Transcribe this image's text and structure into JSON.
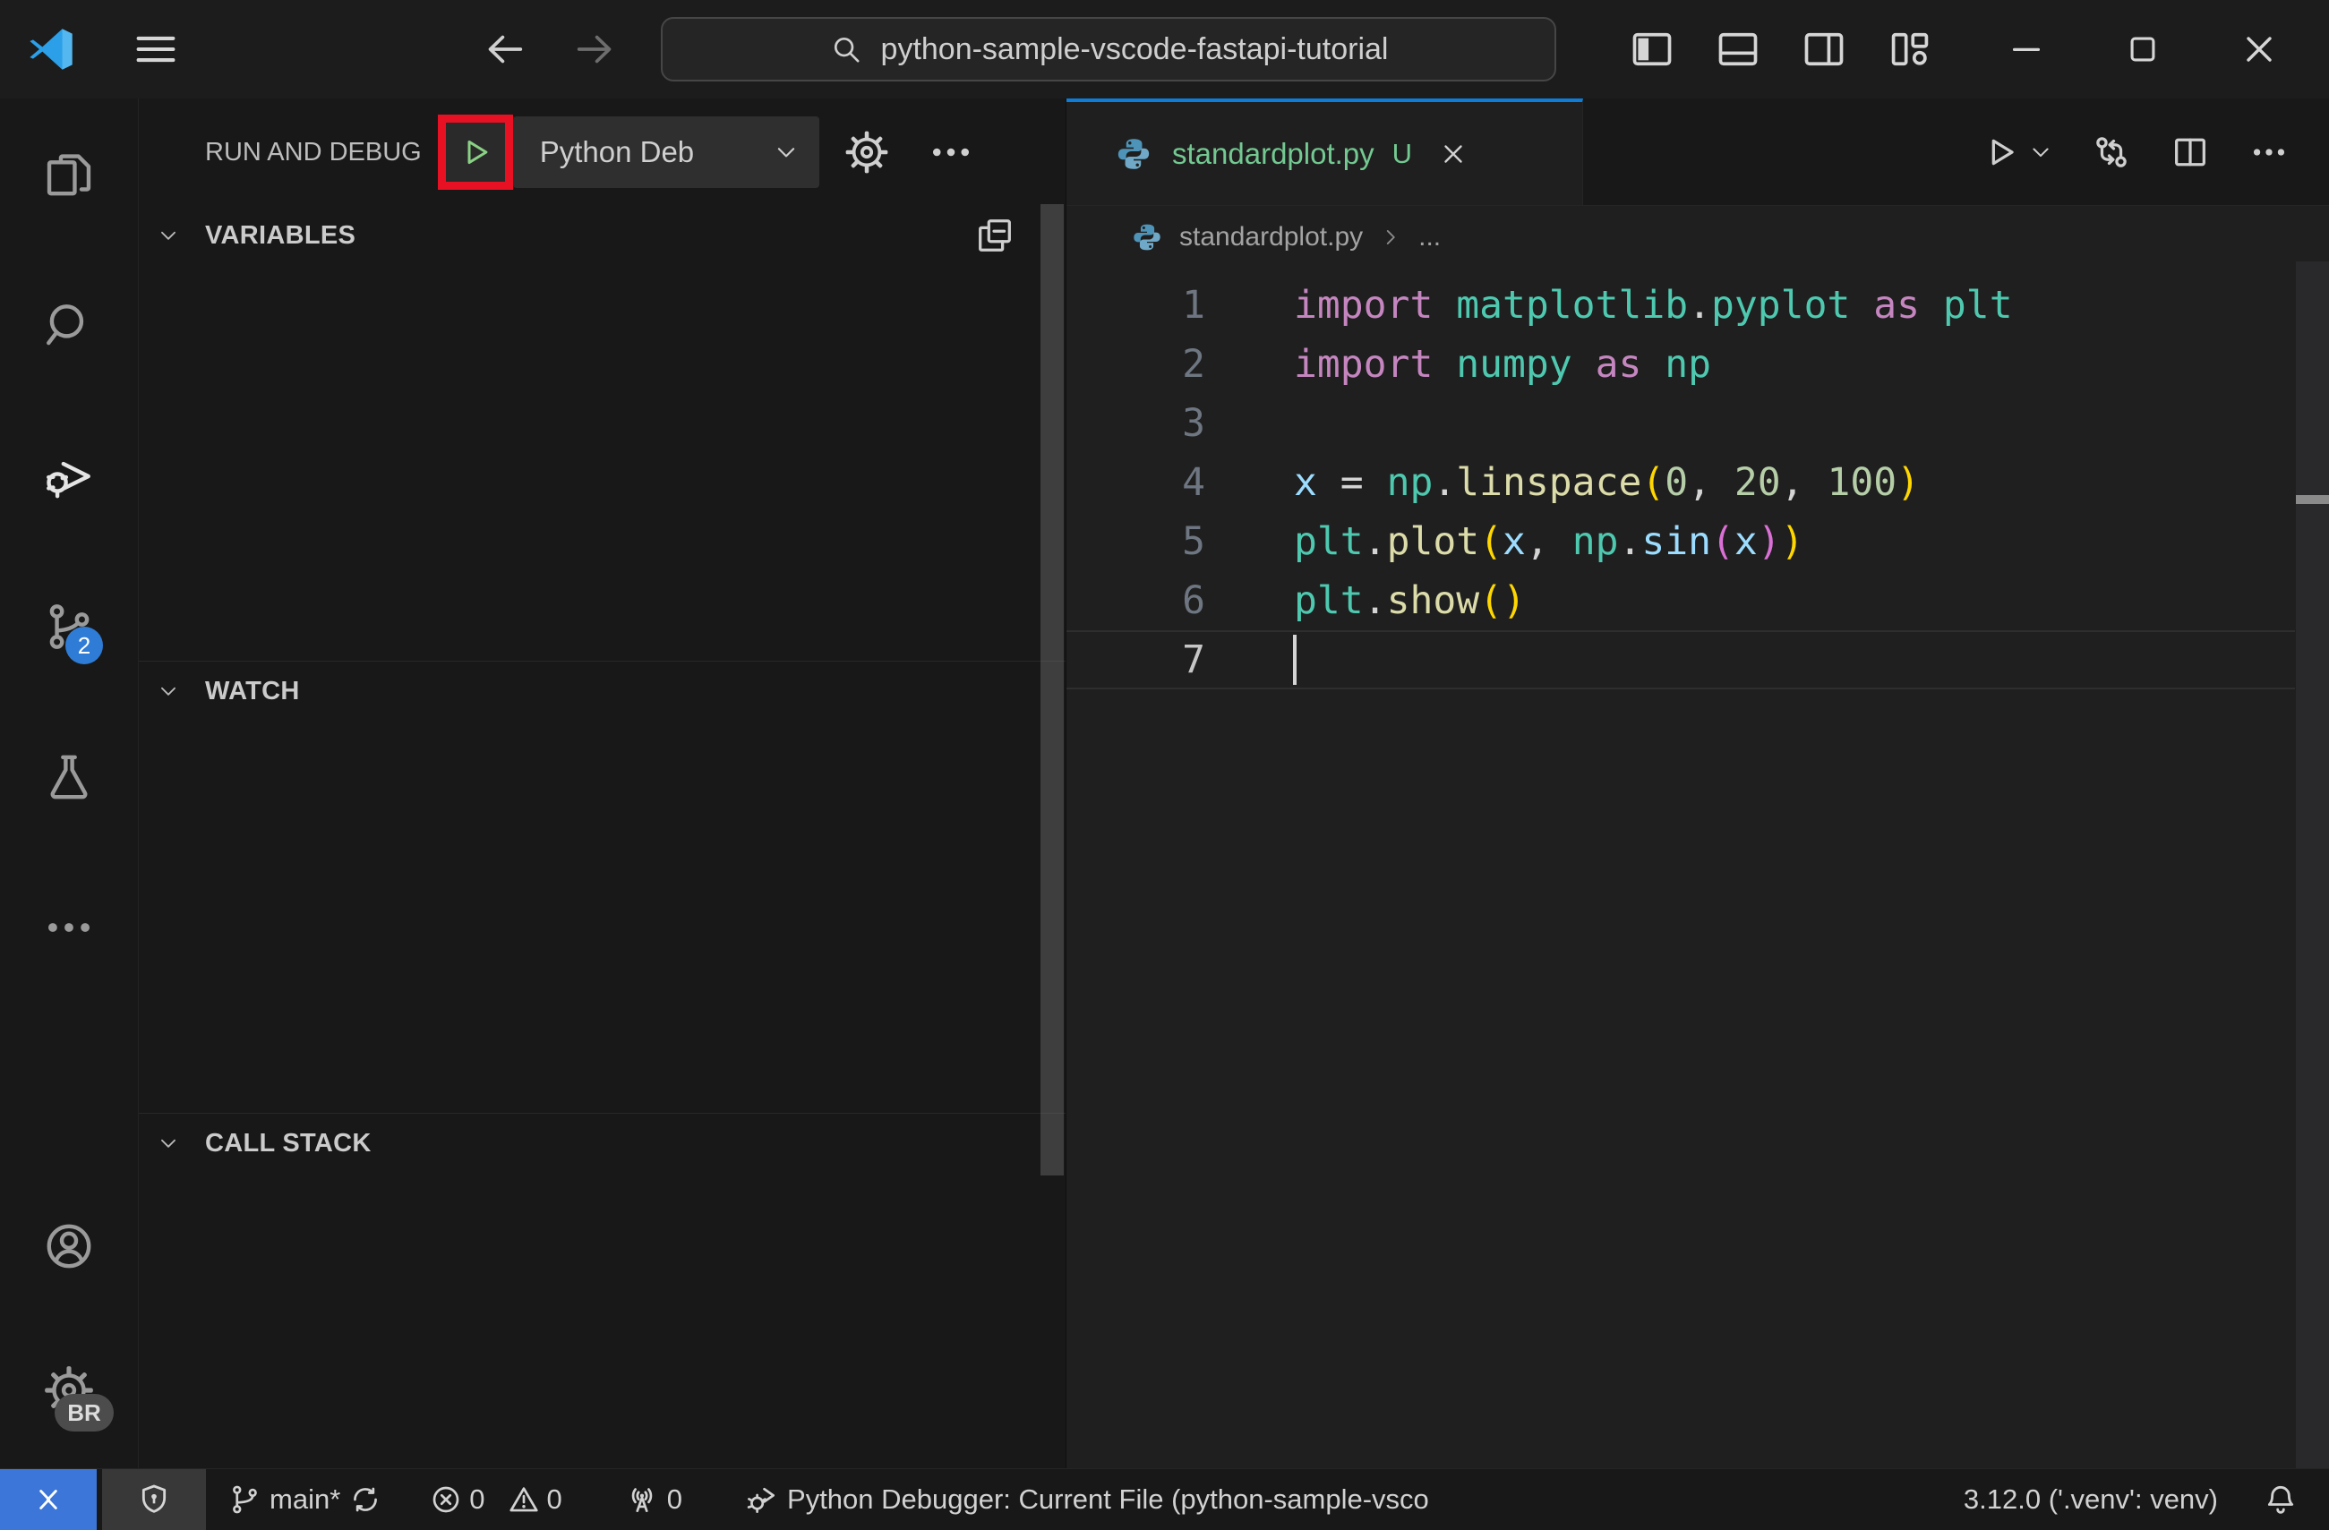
{
  "colors": {
    "accent-blue": "#0c7ed9",
    "remote-blue": "#3b76d8",
    "badge-blue": "#2f7cd6",
    "untracked-green": "#73C991",
    "play-green": "#89D185",
    "annotation-red": "#E81123"
  },
  "titlebar": {
    "search_text": "python-sample-vscode-fastapi-tutorial"
  },
  "activity_bar": {
    "scm_badge": "2",
    "profile_badge": "BR"
  },
  "run_panel": {
    "title": "RUN AND DEBUG",
    "config_label": "Python Deb",
    "sections": [
      {
        "label": "VARIABLES"
      },
      {
        "label": "WATCH"
      },
      {
        "label": "CALL STACK"
      }
    ]
  },
  "editor": {
    "tab": {
      "label": "standardplot.py",
      "modified": "U"
    },
    "breadcrumb": {
      "file": "standardplot.py",
      "symbol": "..."
    },
    "syntax_colors": {
      "kw": "#C586C0",
      "mod": "#4EC9B0",
      "fn": "#DCDCAA",
      "var": "#9CDCFE",
      "num": "#B5CEA8",
      "pl": "#D4D4D4",
      "b1": "#FFD700",
      "b2": "#DA70D6"
    },
    "lines": [
      {
        "num": "1",
        "tokens": [
          [
            "import",
            "kw"
          ],
          [
            " ",
            "pl"
          ],
          [
            "matplotlib",
            "mod"
          ],
          [
            ".",
            "pl"
          ],
          [
            "pyplot",
            "mod"
          ],
          [
            " ",
            "pl"
          ],
          [
            "as",
            "kw"
          ],
          [
            " ",
            "pl"
          ],
          [
            "plt",
            "mod"
          ]
        ]
      },
      {
        "num": "2",
        "tokens": [
          [
            "import",
            "kw"
          ],
          [
            " ",
            "pl"
          ],
          [
            "numpy",
            "mod"
          ],
          [
            " ",
            "pl"
          ],
          [
            "as",
            "kw"
          ],
          [
            " ",
            "pl"
          ],
          [
            "np",
            "mod"
          ]
        ]
      },
      {
        "num": "3",
        "tokens": []
      },
      {
        "num": "4",
        "tokens": [
          [
            "x",
            "var"
          ],
          [
            " = ",
            "pl"
          ],
          [
            "np",
            "mod"
          ],
          [
            ".",
            "pl"
          ],
          [
            "linspace",
            "fn"
          ],
          [
            "(",
            "b1"
          ],
          [
            "0",
            "num"
          ],
          [
            ", ",
            "pl"
          ],
          [
            "20",
            "num"
          ],
          [
            ", ",
            "pl"
          ],
          [
            "100",
            "num"
          ],
          [
            ")",
            "b1"
          ]
        ]
      },
      {
        "num": "5",
        "tokens": [
          [
            "plt",
            "mod"
          ],
          [
            ".",
            "pl"
          ],
          [
            "plot",
            "fn"
          ],
          [
            "(",
            "b1"
          ],
          [
            "x",
            "var"
          ],
          [
            ", ",
            "pl"
          ],
          [
            "np",
            "mod"
          ],
          [
            ".",
            "pl"
          ],
          [
            "sin",
            "var"
          ],
          [
            "(",
            "b2"
          ],
          [
            "x",
            "var"
          ],
          [
            ")",
            "b2"
          ],
          [
            ")",
            "b1"
          ]
        ]
      },
      {
        "num": "6",
        "tokens": [
          [
            "plt",
            "mod"
          ],
          [
            ".",
            "pl"
          ],
          [
            "show",
            "fn"
          ],
          [
            "(",
            "b1"
          ],
          [
            ")",
            "b1"
          ]
        ]
      },
      {
        "num": "7",
        "tokens": [],
        "active": true
      }
    ]
  },
  "status_bar": {
    "branch": "main*",
    "errors": "0",
    "warnings": "0",
    "ports": "0",
    "debug_config": "Python Debugger: Current File (python-sample-vsco",
    "python_version": "3.12.0 ('.venv': venv)"
  }
}
